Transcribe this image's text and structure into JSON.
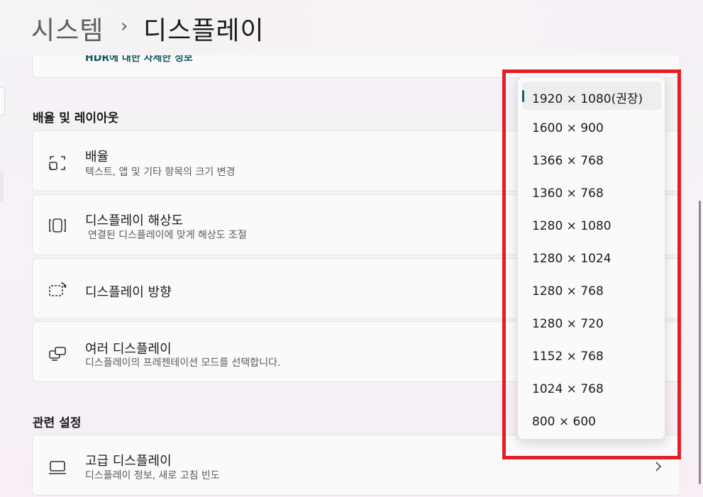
{
  "breadcrumb": {
    "parent": "시스템",
    "separator": "›",
    "current": "디스플레이"
  },
  "hdr_card": {
    "link": "HDR에 대한 자세한 정보"
  },
  "section_scale": "배율 및 레이아웃",
  "rows": {
    "scale": {
      "title": "배율",
      "subtitle": "텍스트, 앱 및 기타 항목의 크기 변경",
      "icon": "scale-icon"
    },
    "resolution": {
      "title": "디스플레이 해상도",
      "subtitle": "연결된 디스플레이에 맞게 해상도 조절",
      "icon": "resolution-icon"
    },
    "orientation": {
      "title": "디스플레이 방향",
      "icon": "orientation-icon"
    },
    "multiple": {
      "title": "여러 디스플레이",
      "subtitle": "디스플레이의 프레젠테이션 모드를 선택합니다.",
      "icon": "multiple-displays-icon"
    }
  },
  "section_related": "관련 설정",
  "related": {
    "advanced": {
      "title": "고급 디스플레이",
      "subtitle": "디스플레이 정보, 새로 고침 빈도",
      "icon": "monitor-icon"
    }
  },
  "resolution_options": [
    "1920 × 1080(권장)",
    "1600 × 900",
    "1366 × 768",
    "1360 × 768",
    "1280 × 1080",
    "1280 × 1024",
    "1280 × 768",
    "1280 × 720",
    "1152 × 768",
    "1024 × 768",
    "800 × 600"
  ],
  "selected_index": 0,
  "colors": {
    "accent": "#0f6170",
    "highlight": "#e41e25"
  }
}
